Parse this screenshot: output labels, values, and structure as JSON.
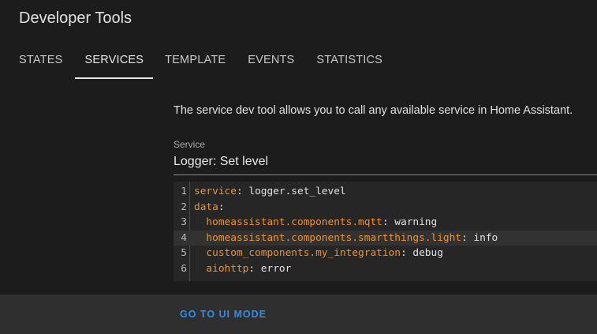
{
  "header": {
    "title": "Developer Tools"
  },
  "tabs": [
    {
      "label": "STATES",
      "active": false
    },
    {
      "label": "SERVICES",
      "active": true
    },
    {
      "label": "TEMPLATE",
      "active": false
    },
    {
      "label": "EVENTS",
      "active": false
    },
    {
      "label": "STATISTICS",
      "active": false
    }
  ],
  "main": {
    "description": "The service dev tool allows you to call any available service in Home Assistant.",
    "service_field": {
      "label": "Service",
      "value": "Logger: Set level"
    },
    "editor": {
      "lines": [
        {
          "num": "1",
          "indent": "",
          "key": "service",
          "sep": ": ",
          "value": "logger.set_level"
        },
        {
          "num": "2",
          "indent": "",
          "key": "data",
          "sep": ":",
          "value": ""
        },
        {
          "num": "3",
          "indent": "  ",
          "key": "homeassistant.components.mqtt",
          "sep": ": ",
          "value": "warning"
        },
        {
          "num": "4",
          "indent": "  ",
          "key": "homeassistant.components.smartthings.light",
          "sep": ": ",
          "value": "info"
        },
        {
          "num": "5",
          "indent": "  ",
          "key": "custom_components.my_integration",
          "sep": ": ",
          "value": "debug"
        },
        {
          "num": "6",
          "indent": "  ",
          "key": "aiohttp",
          "sep": ": ",
          "value": "error"
        }
      ],
      "highlighted_line": "4"
    }
  },
  "footer": {
    "ui_mode_label": "GO TO UI MODE"
  },
  "colors": {
    "yaml_key": "#f0932b",
    "link_blue": "#2d8fe8",
    "background": "#1c1c1c",
    "footer_bg": "#2f2f2f"
  }
}
